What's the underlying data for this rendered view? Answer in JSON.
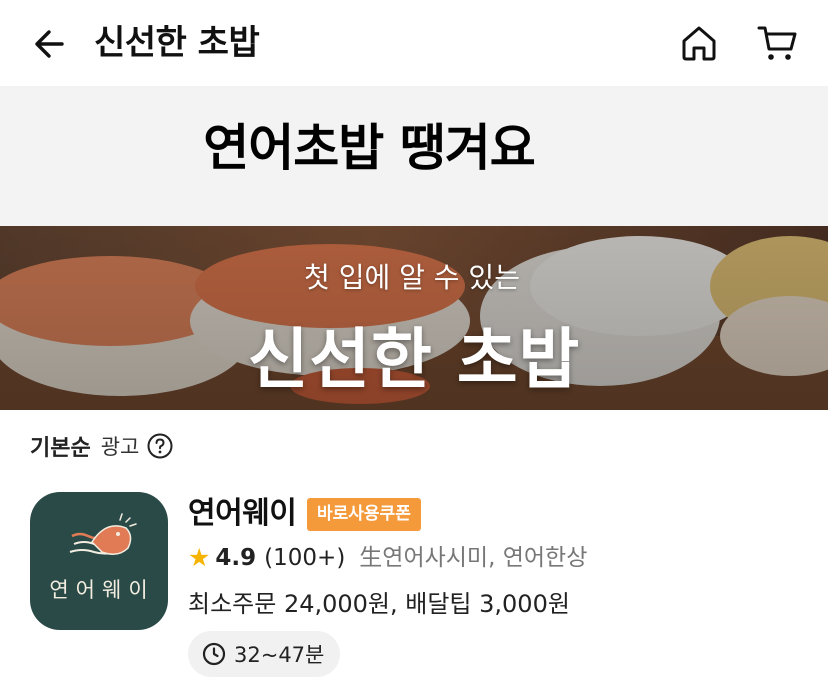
{
  "header": {
    "title": "신선한 초밥",
    "back_icon": "arrow-left-icon",
    "home_icon": "home-icon",
    "cart_icon": "cart-icon"
  },
  "promo": {
    "text": "연어초밥 땡겨요"
  },
  "banner": {
    "subtitle": "첫 입에 알 수 있는",
    "title": "신선한 초밥"
  },
  "list": {
    "sort_label": "기본순",
    "ad_label": "광고",
    "help_icon": "question-circle-icon"
  },
  "store": {
    "logo_text": "연어웨이",
    "name": "연어웨이",
    "coupon_badge": "바로사용쿠폰",
    "rating": "4.9",
    "review_count": "(100+)",
    "category": "生연어사시미, 연어한상",
    "min_order_fee": "최소주문 24,000원, 배달팁 3,000원",
    "delivery_time": "32~47분",
    "clock_icon": "clock-icon"
  },
  "colors": {
    "coupon_bg": "#f59a3b",
    "star": "#f6b400",
    "logo_bg": "#2a4a47",
    "promo_bg": "#f3f3f3"
  }
}
